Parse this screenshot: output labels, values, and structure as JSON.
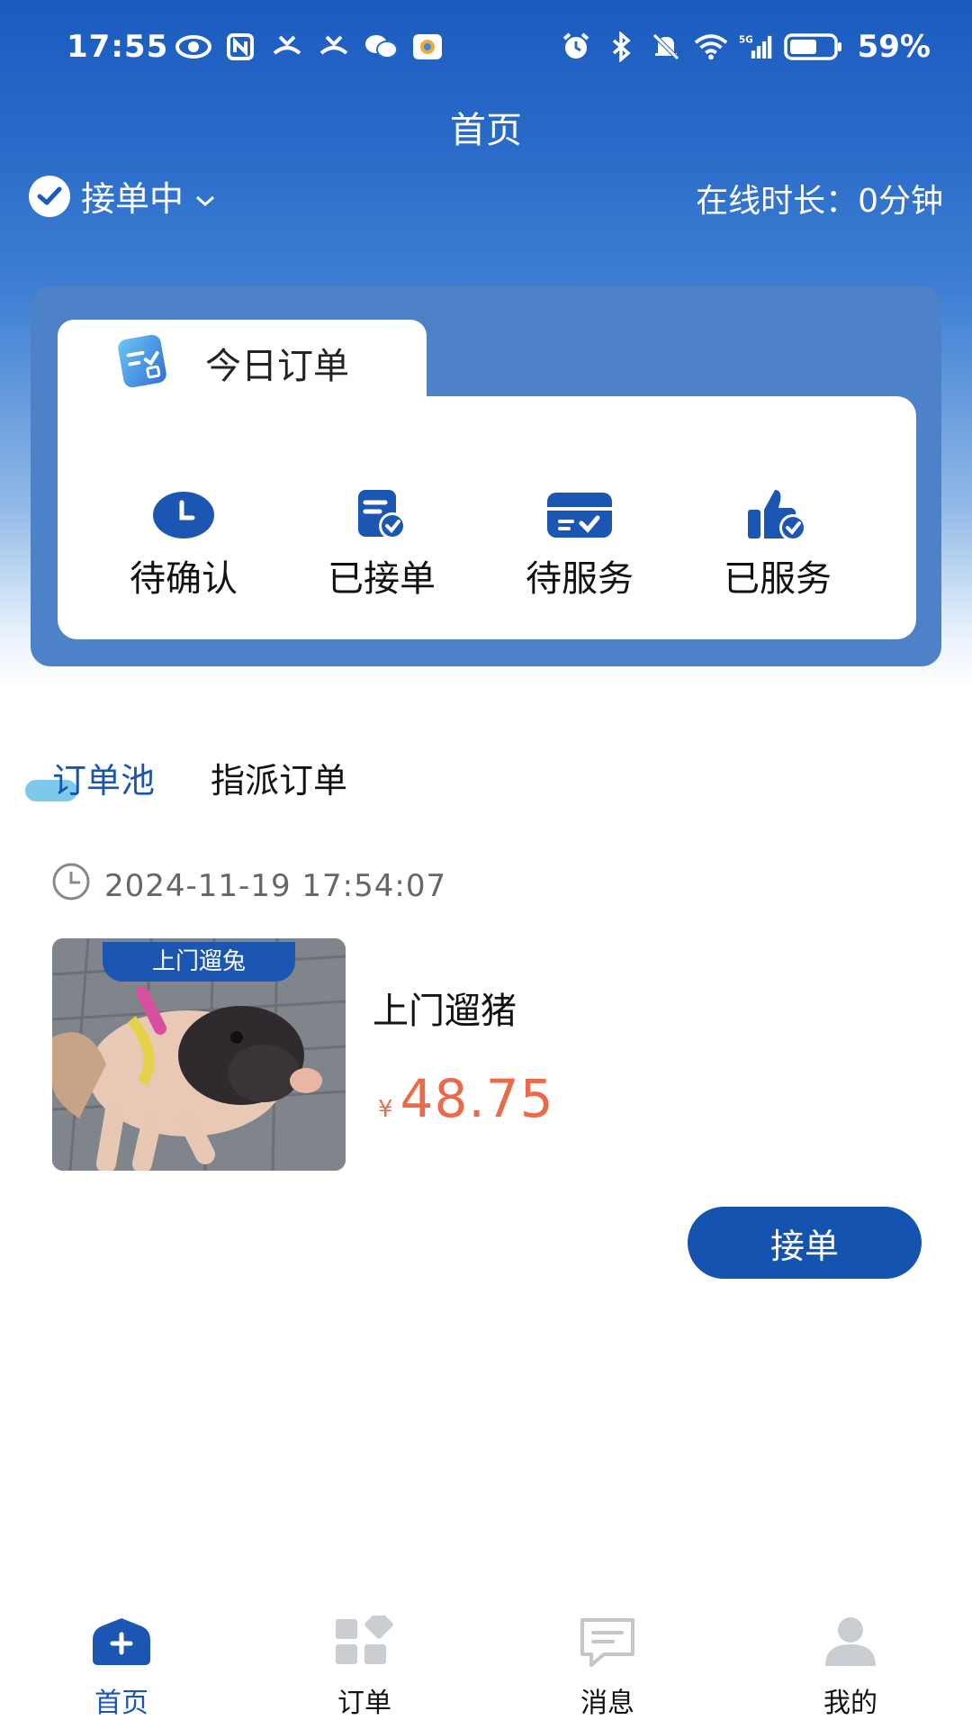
{
  "status_bar": {
    "time": "17:55",
    "battery": "59%",
    "left_icons": [
      "eye-icon",
      "nfc-icon",
      "missed-call-icon",
      "missed-call-icon",
      "wechat-icon",
      "app-icon"
    ],
    "right_icons": [
      "alarm-icon",
      "bluetooth-icon",
      "mute-icon",
      "wifi-icon",
      "signal-5g-icon",
      "battery-icon"
    ]
  },
  "header": {
    "title": "首页",
    "accept_status": "接单中",
    "online_label": "在线时长：",
    "online_value": "0分钟"
  },
  "today_orders": {
    "title": "今日订单",
    "items": [
      {
        "label": "待确认",
        "icon": "clock-icon"
      },
      {
        "label": "已接单",
        "icon": "document-check-icon"
      },
      {
        "label": "待服务",
        "icon": "inbox-check-icon"
      },
      {
        "label": "已服务",
        "icon": "thumbs-up-icon"
      }
    ]
  },
  "pool_tabs": {
    "items": [
      {
        "label": "订单池",
        "active": true
      },
      {
        "label": "指派订单",
        "active": false
      }
    ]
  },
  "order": {
    "time": "2024-11-19 17:54:07",
    "image_badge": "上门遛兔",
    "name": "上门遛猪",
    "currency": "¥",
    "price": "48.75",
    "accept_label": "接单"
  },
  "bottom_nav": {
    "items": [
      {
        "label": "首页",
        "icon": "home-plus-icon",
        "active": true
      },
      {
        "label": "订单",
        "icon": "grid-icon",
        "active": false
      },
      {
        "label": "消息",
        "icon": "message-icon",
        "active": false
      },
      {
        "label": "我的",
        "icon": "user-icon",
        "active": false
      }
    ]
  },
  "colors": {
    "primary": "#1454b0",
    "header": "#1a5bbf",
    "price": "#ec6a4a",
    "tab_indicator": "#6fc3ea"
  }
}
